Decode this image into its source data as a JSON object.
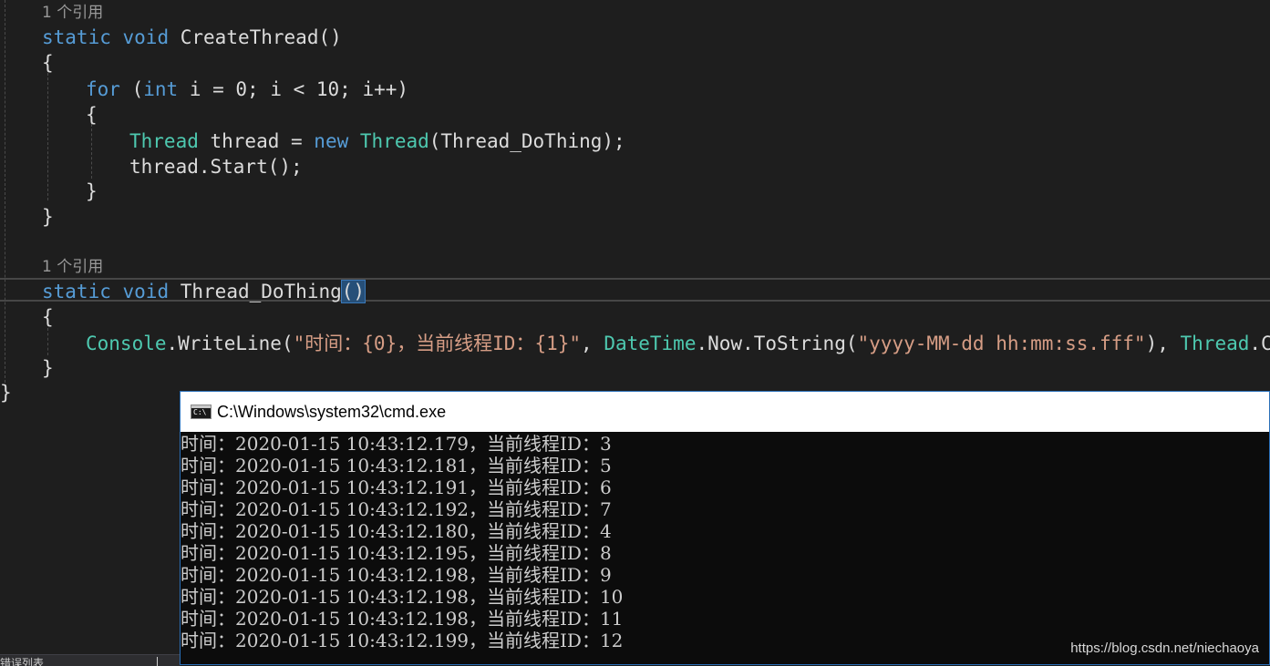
{
  "editor": {
    "ref_label": "1 个引用",
    "method1": {
      "kw_static": "static",
      "kw_void": "void",
      "name": "CreateThread",
      "parens": "()",
      "open_brace": "{",
      "kw_for": "for",
      "for_open": " (",
      "kw_int": "int",
      "for_cond": " i = 0; i < 10; i++)",
      "inner_open": "{",
      "type_thread": "Thread",
      "var_decl": " thread = ",
      "kw_new": "new",
      "space": " ",
      "type_thread2": "Thread",
      "ctor_args": "(Thread_DoThing);",
      "start_call": "thread.Start();",
      "inner_close": "}",
      "close_brace": "}"
    },
    "method2": {
      "kw_static": "static",
      "kw_void": "void",
      "name": "Thread_DoThing",
      "parens": "()",
      "open_brace": "{",
      "console": "Console",
      "writeline": ".WriteLine(",
      "format_str": "\"时间：{0}，当前线程ID：{1}\"",
      "comma1": ", ",
      "datetime": "DateTime",
      "now_tostring": ".Now.ToString(",
      "date_fmt": "\"yyyy-MM-dd hh:mm:ss.fff\"",
      "close_paren": "), ",
      "thread_type": "Thread",
      "thread_curr": ".Curr",
      "close_brace": "}"
    },
    "class_close": "}"
  },
  "cmd_window": {
    "title": "C:\\Windows\\system32\\cmd.exe",
    "icon": "cmd-icon",
    "icon_text": "C:\\",
    "output_lines": [
      "时间：2020-01-15 10:43:12.179，当前线程ID：3",
      "时间：2020-01-15 10:43:12.181，当前线程ID：5",
      "时间：2020-01-15 10:43:12.191，当前线程ID：6",
      "时间：2020-01-15 10:43:12.192，当前线程ID：7",
      "时间：2020-01-15 10:43:12.180，当前线程ID：4",
      "时间：2020-01-15 10:43:12.195，当前线程ID：8",
      "时间：2020-01-15 10:43:12.198，当前线程ID：9",
      "时间：2020-01-15 10:43:12.198，当前线程ID：10",
      "时间：2020-01-15 10:43:12.198，当前线程ID：11",
      "时间：2020-01-15 10:43:12.199，当前线程ID：12"
    ]
  },
  "bottom_panel": {
    "tab_label": "错误列表"
  },
  "watermark": "https://blog.csdn.net/niechaoya",
  "colors": {
    "keyword": "#569cd6",
    "type": "#4ec9b0",
    "string": "#d69d85",
    "plain": "#dcdcdc",
    "editor_bg": "#1e1e1e",
    "console_bg": "#0c0c0c"
  }
}
